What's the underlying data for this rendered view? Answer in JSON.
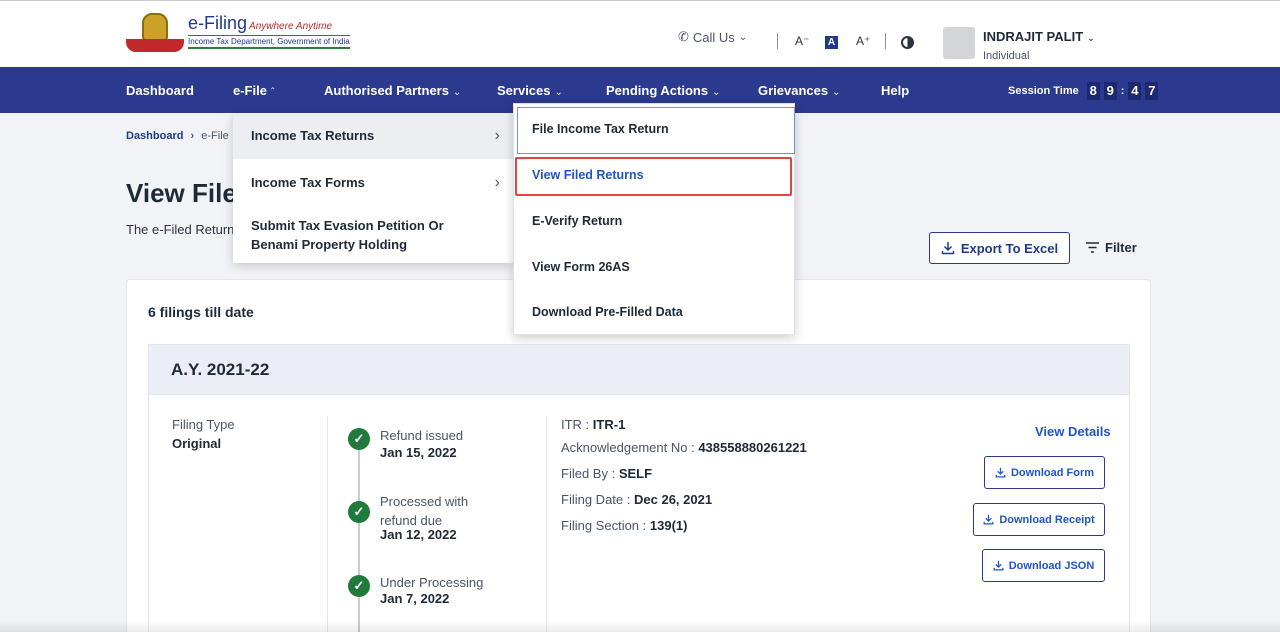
{
  "header": {
    "logo_title": "e-Filing",
    "logo_tagline": "Anywhere Anytime",
    "logo_subtitle": "Income Tax Department, Government of India",
    "call_us": "Call Us",
    "font_decrease": "A⁻",
    "font_normal": "A",
    "font_increase": "A⁺",
    "user_name": "INDRAJIT PALIT",
    "user_role": "Individual"
  },
  "nav": {
    "items": [
      "Dashboard",
      "e-File",
      "Authorised Partners",
      "Services",
      "Pending Actions",
      "Grievances",
      "Help"
    ],
    "session_label": "Session Time",
    "session_digits": [
      "8",
      "9",
      "4",
      "7"
    ]
  },
  "breadcrumb": {
    "root": "Dashboard",
    "current": "e-File"
  },
  "page": {
    "title": "View Filed Returns",
    "subtitle": "The e-Filed Returns / Forms",
    "export_label": "Export To Excel",
    "filter_label": "Filter",
    "filings_count": "6 filings till date"
  },
  "efile_menu": {
    "items": [
      "Income Tax Returns",
      "Income Tax Forms",
      "Submit Tax Evasion Petition Or Benami Property Holding"
    ]
  },
  "itr_submenu": {
    "items": [
      "File Income Tax Return",
      "View Filed Returns",
      "E-Verify Return",
      "View Form 26AS",
      "Download Pre-Filled Data"
    ],
    "selected": "View Filed Returns"
  },
  "filing": {
    "ay": "A.Y. 2021-22",
    "filing_type_label": "Filing Type",
    "filing_type": "Original",
    "timeline": [
      {
        "status": "Refund issued",
        "date": "Jan 15, 2022"
      },
      {
        "status": "Processed with refund due",
        "date": "Jan 12, 2022"
      },
      {
        "status": "Under Processing",
        "date": "Jan 7, 2022"
      }
    ],
    "itr_label": "ITR :",
    "itr": "ITR-1",
    "ack_label": "Acknowledgement No :",
    "ack": "438558880261221",
    "filed_by_label": "Filed By :",
    "filed_by": "SELF",
    "filing_date_label": "Filing Date :",
    "filing_date": "Dec 26, 2021",
    "filing_section_label": "Filing Section :",
    "filing_section": "139(1)",
    "view_details": "View Details",
    "download_form": "Download Form",
    "download_receipt": "Download Receipt",
    "download_json": "Download JSON"
  },
  "colors": {
    "nav_bg": "#2b3a8f",
    "accent": "#1e55c8",
    "success": "#1f7a3b",
    "highlight_border": "#e1453c"
  },
  "icons": [
    "phone-icon",
    "contrast-icon",
    "download-icon",
    "filter-icon",
    "check-icon",
    "chevron-right-icon",
    "chevron-down-icon"
  ]
}
